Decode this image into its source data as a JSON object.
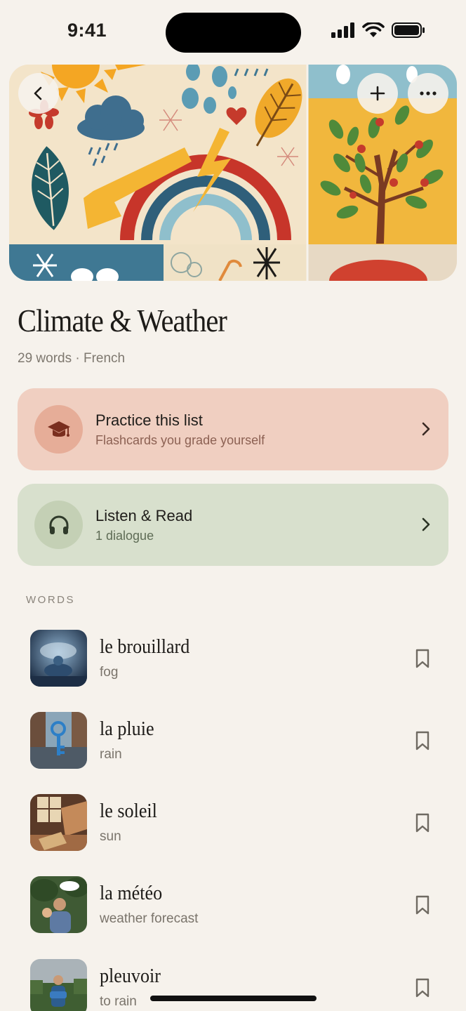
{
  "status": {
    "time": "9:41"
  },
  "hero": {
    "back_icon": "chevron-left-icon",
    "add_icon": "plus-icon",
    "more_icon": "ellipsis-icon"
  },
  "list": {
    "title": "Climate & Weather",
    "meta": "29 words · French"
  },
  "actions": [
    {
      "title": "Practice this list",
      "subtitle": "Flashcards you grade yourself",
      "icon": "graduation-cap-icon",
      "color": "#f0cfc1"
    },
    {
      "title": "Listen & Read",
      "subtitle": "1 dialogue",
      "icon": "headphones-icon",
      "color": "#d8e0cd"
    }
  ],
  "words_section": {
    "label": "WORDS",
    "items": [
      {
        "french": "le brouillard",
        "english": "fog"
      },
      {
        "french": "la pluie",
        "english": "rain"
      },
      {
        "french": "le soleil",
        "english": "sun"
      },
      {
        "french": "la météo",
        "english": "weather forecast"
      },
      {
        "french": "pleuvoir",
        "english": "to rain"
      }
    ]
  }
}
